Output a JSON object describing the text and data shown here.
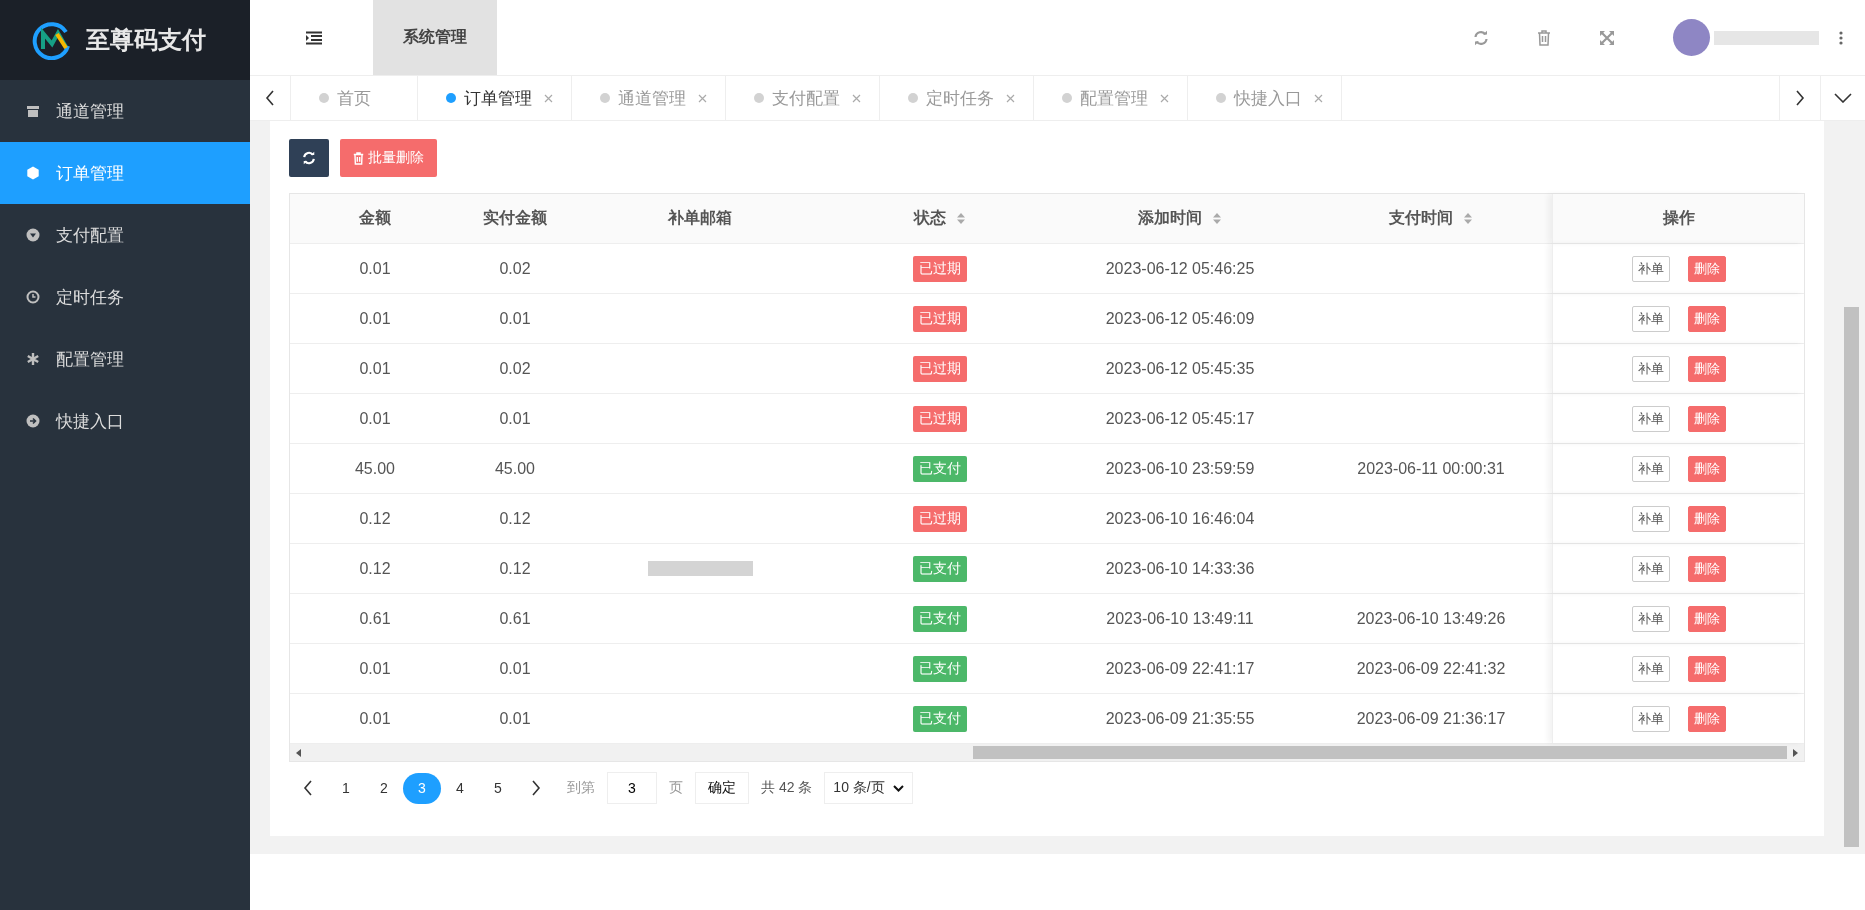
{
  "brand": {
    "name": "至尊码支付"
  },
  "header": {
    "menu_tab": "系统管理",
    "user_redacted": true
  },
  "sidebar": {
    "items": [
      {
        "label": "通道管理",
        "selected": false
      },
      {
        "label": "订单管理",
        "selected": true
      },
      {
        "label": "支付配置",
        "selected": false
      },
      {
        "label": "定时任务",
        "selected": false
      },
      {
        "label": "配置管理",
        "selected": false
      },
      {
        "label": "快捷入口",
        "selected": false
      }
    ]
  },
  "tabs": [
    {
      "label": "首页",
      "selected": false,
      "closable": false
    },
    {
      "label": "订单管理",
      "selected": true,
      "closable": true
    },
    {
      "label": "通道管理",
      "selected": false,
      "closable": true
    },
    {
      "label": "支付配置",
      "selected": false,
      "closable": true
    },
    {
      "label": "定时任务",
      "selected": false,
      "closable": true
    },
    {
      "label": "配置管理",
      "selected": false,
      "closable": true
    },
    {
      "label": "快捷入口",
      "selected": false,
      "closable": true
    }
  ],
  "toolbar": {
    "batch_delete": "批量删除"
  },
  "table": {
    "columns": [
      {
        "label": "金额",
        "sortable": false
      },
      {
        "label": "实付金额",
        "sortable": false
      },
      {
        "label": "补单邮箱",
        "sortable": false
      },
      {
        "label": "状态",
        "sortable": true
      },
      {
        "label": "添加时间",
        "sortable": true
      },
      {
        "label": "支付时间",
        "sortable": true
      },
      {
        "label": "操作",
        "sortable": false
      }
    ],
    "rows": [
      {
        "amount": "0.01",
        "paid": "0.02",
        "status": {
          "label": "已过期",
          "color": "#f56c6c"
        },
        "added": "2023-06-12 05:46:25",
        "actions": [
          "补单",
          "删除"
        ]
      },
      {
        "amount": "0.01",
        "paid": "0.01",
        "status": {
          "label": "已过期",
          "color": "#f56c6c"
        },
        "added": "2023-06-12 05:46:09",
        "actions": [
          "补单",
          "删除"
        ]
      },
      {
        "amount": "0.01",
        "paid": "0.02",
        "status": {
          "label": "已过期",
          "color": "#f56c6c"
        },
        "added": "2023-06-12 05:45:35",
        "actions": [
          "补单",
          "删除"
        ]
      },
      {
        "amount": "0.01",
        "paid": "0.01",
        "status": {
          "label": "已过期",
          "color": "#f56c6c"
        },
        "added": "2023-06-12 05:45:17",
        "actions": [
          "补单",
          "删除"
        ]
      },
      {
        "amount": "45.00",
        "paid": "45.00",
        "status": {
          "label": "已支付",
          "color": "#4cb869"
        },
        "added": "2023-06-10 23:59:59",
        "paid_at": "2023-06-11 00:00:31",
        "actions": [
          "补单",
          "删除"
        ]
      },
      {
        "amount": "0.12",
        "paid": "0.12",
        "status": {
          "label": "已过期",
          "color": "#f56c6c"
        },
        "added": "2023-06-10 16:46:04",
        "actions": [
          "补单",
          "删除"
        ]
      },
      {
        "amount": "0.12",
        "paid": "0.12",
        "email_redacted": true,
        "status": {
          "label": "已支付",
          "color": "#4cb869"
        },
        "added": "2023-06-10 14:33:36",
        "actions": [
          "补单",
          "删除"
        ]
      },
      {
        "amount": "0.61",
        "paid": "0.61",
        "status": {
          "label": "已支付",
          "color": "#4cb869"
        },
        "added": "2023-06-10 13:49:11",
        "paid_at": "2023-06-10 13:49:26",
        "actions": [
          "补单",
          "删除"
        ]
      },
      {
        "amount": "0.01",
        "paid": "0.01",
        "status": {
          "label": "已支付",
          "color": "#4cb869"
        },
        "added": "2023-06-09 22:41:17",
        "paid_at": "2023-06-09 22:41:32",
        "actions": [
          "补单",
          "删除"
        ]
      },
      {
        "amount": "0.01",
        "paid": "0.01",
        "status": {
          "label": "已支付",
          "color": "#4cb869"
        },
        "added": "2023-06-09 21:35:55",
        "paid_at": "2023-06-09 21:36:17",
        "actions": [
          "补单",
          "删除"
        ]
      }
    ]
  },
  "pagination": {
    "pages": [
      {
        "label": "1",
        "selected": false
      },
      {
        "label": "2",
        "selected": false
      },
      {
        "label": "3",
        "selected": true
      },
      {
        "label": "4",
        "selected": false
      },
      {
        "label": "5",
        "selected": false
      }
    ],
    "goto_label": "到第",
    "goto_value": "3",
    "page_unit": "页",
    "confirm": "确定",
    "total": "共 42 条",
    "page_size": "10 条/页"
  }
}
